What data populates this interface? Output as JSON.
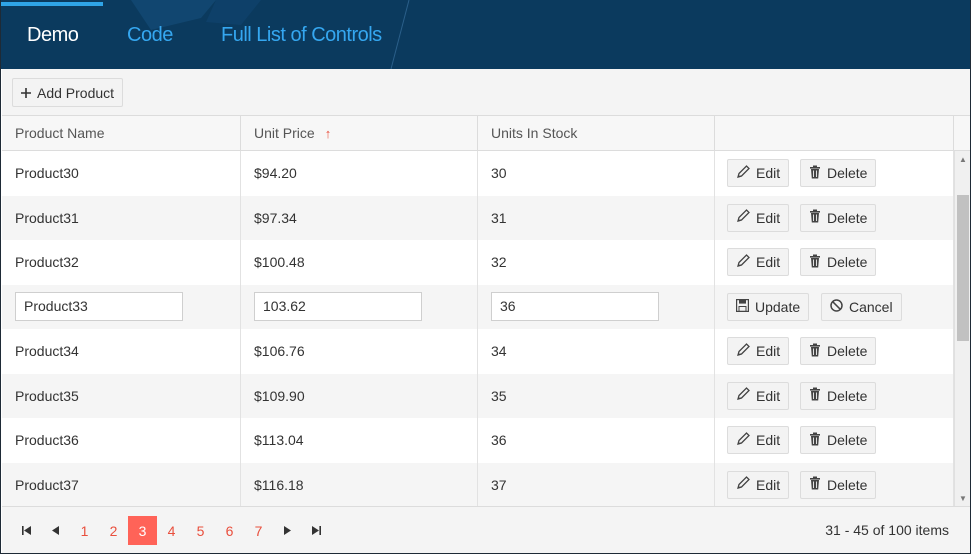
{
  "tabs": [
    {
      "label": "Demo"
    },
    {
      "label": "Code"
    },
    {
      "label": "Full List of Controls"
    }
  ],
  "toolbar": {
    "add_label": "Add Product"
  },
  "columns": [
    {
      "label": "Product Name"
    },
    {
      "label": "Unit Price",
      "sort": "ascending"
    },
    {
      "label": "Units In Stock"
    },
    {
      "label": ""
    }
  ],
  "row_actions": {
    "edit": "Edit",
    "delete": "Delete",
    "update": "Update",
    "cancel": "Cancel"
  },
  "rows": [
    {
      "name": "Product30",
      "price": "$94.20",
      "stock": "30"
    },
    {
      "name": "Product31",
      "price": "$97.34",
      "stock": "31"
    },
    {
      "name": "Product32",
      "price": "$100.48",
      "stock": "32"
    },
    {
      "name": "Product33",
      "price": "103.62",
      "stock": "36",
      "editing": true
    },
    {
      "name": "Product34",
      "price": "$106.76",
      "stock": "34"
    },
    {
      "name": "Product35",
      "price": "$109.90",
      "stock": "35"
    },
    {
      "name": "Product36",
      "price": "$113.04",
      "stock": "36"
    },
    {
      "name": "Product37",
      "price": "$116.18",
      "stock": "37"
    }
  ],
  "pager": {
    "pages": [
      "1",
      "2",
      "3",
      "4",
      "5",
      "6",
      "7"
    ],
    "current": "3",
    "info": "31 - 45 of 100 items"
  },
  "colors": {
    "header_bg": "#0b3a5e",
    "tab_active": "#ffffff",
    "tab_link": "#35a7f0",
    "accent": "#ff6358",
    "link": "#e94f3d"
  }
}
